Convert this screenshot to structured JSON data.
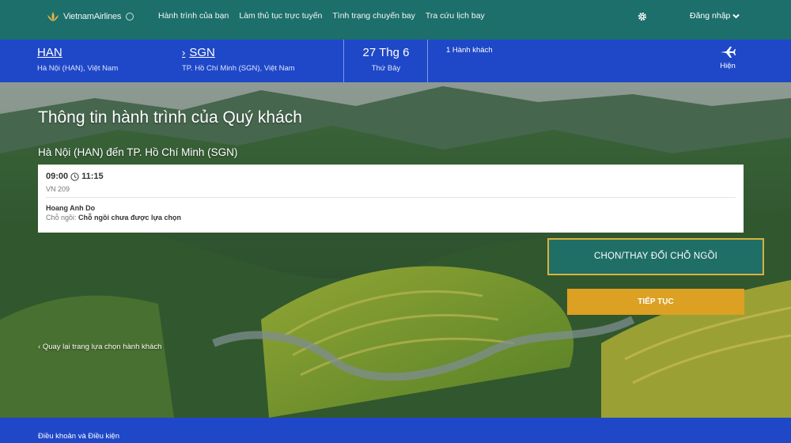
{
  "header": {
    "brand": "VietnamAirlines",
    "nav": [
      "Hành trình của bạn",
      "Làm thủ tục trực tuyến",
      "Tình trạng chuyến bay",
      "Tra cứu lịch bay"
    ],
    "settings_icon": "gear-icon",
    "login": "Đăng nhập"
  },
  "summary": {
    "origin_code": "HAN",
    "origin_city": "Hà Nội (HAN), Việt Nam",
    "destination_code": "SGN",
    "destination_city": "TP. Hồ Chí Minh (SGN), Việt Nam",
    "date": "27 Thg 6",
    "weekday": "Thứ Bảy",
    "passengers": "1 Hành khách",
    "show_label": "Hiện"
  },
  "main": {
    "title": "Thông tin hành trình của Quý khách",
    "route": "Hà Nội (HAN) đến TP. Hồ Chí Minh (SGN)",
    "flight": {
      "depart": "09:00",
      "arrive": "11:15",
      "number": "VN 209",
      "passenger": "Hoang Anh Do",
      "seat_label": "Chỗ ngồi:",
      "seat_value": "Chỗ ngồi chưa được lựa chọn"
    },
    "seat_button": "CHỌN/THAY ĐỔI CHỖ NGỒI",
    "continue_button": "TIẾP TỤC",
    "back_link": "Quay lại trang lựa chọn hành khách"
  },
  "footer": {
    "terms": "Điều khoản và Điều kiện"
  },
  "colors": {
    "topbar": "#1c6f6a",
    "summary_bar": "#1f48c8",
    "seat_button": "#1f6f66",
    "seat_button_border": "#d9b23c",
    "continue_button": "#dca022"
  }
}
